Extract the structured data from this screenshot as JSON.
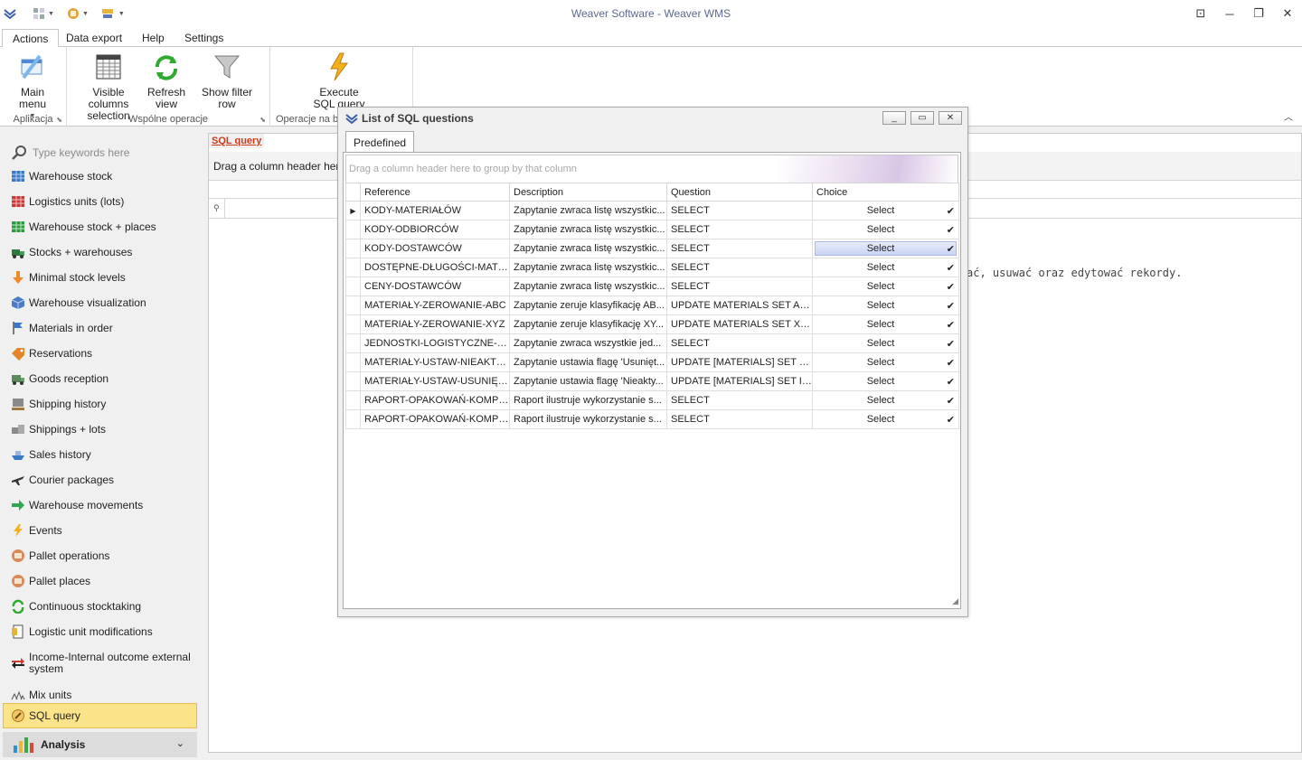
{
  "window": {
    "title": "Weaver Software - Weaver WMS"
  },
  "ribbon": {
    "tabs": [
      "Actions",
      "Data export",
      "Help",
      "Settings"
    ],
    "groups": {
      "aplikacja": {
        "caption": "Aplikacja",
        "main_menu": "Main menu"
      },
      "wspolne": {
        "caption": "Wspólne operacje",
        "visible_columns": "Visible columns selection",
        "refresh": "Refresh view",
        "show_filter": "Show filter row"
      },
      "operacje": {
        "caption": "Operacje na b",
        "execute": "Execute SQL query"
      }
    }
  },
  "nav": {
    "search_placeholder": "Type keywords here",
    "items": [
      {
        "label": "Warehouse stock",
        "icon": "grid-blue-icon"
      },
      {
        "label": "Logistics units (lots)",
        "icon": "grid-red-icon"
      },
      {
        "label": "Warehouse stock + places",
        "icon": "grid-green-icon"
      },
      {
        "label": "Stocks + warehouses",
        "icon": "truck-icon"
      },
      {
        "label": "Minimal stock levels",
        "icon": "down-arrow-icon"
      },
      {
        "label": "Warehouse visualization",
        "icon": "cube-icon"
      },
      {
        "label": "Materials in order",
        "icon": "flag-icon"
      },
      {
        "label": "Reservations",
        "icon": "tag-icon"
      },
      {
        "label": "Goods reception",
        "icon": "truck-in-icon"
      },
      {
        "label": "Shipping history",
        "icon": "pallet-icon"
      },
      {
        "label": "Shippings + lots",
        "icon": "boxes-icon"
      },
      {
        "label": "Sales history",
        "icon": "ship-icon"
      },
      {
        "label": "Courier packages",
        "icon": "plane-icon"
      },
      {
        "label": "Warehouse movements",
        "icon": "arrow-right-icon"
      },
      {
        "label": "Events",
        "icon": "lightning-icon"
      },
      {
        "label": "Pallet operations",
        "icon": "pallet-circle-icon"
      },
      {
        "label": "Pallet places",
        "icon": "pallet-circle-icon"
      },
      {
        "label": "Continuous stocktaking",
        "icon": "cycle-icon"
      },
      {
        "label": "Logistic unit modifications",
        "icon": "document-icon"
      },
      {
        "label": "Income-Internal outcome external system",
        "icon": "swap-arrows-icon"
      },
      {
        "label": "Mix units",
        "icon": "mix-icon"
      }
    ],
    "active": {
      "label": "SQL query",
      "icon": "sql-icon"
    },
    "analysis": {
      "label": "Analysis"
    }
  },
  "doc": {
    "tab": "SQL query",
    "group_hint": "Drag a column header here t",
    "message": "ać, usuwać oraz edytować rekordy."
  },
  "dialog": {
    "title": "List of SQL questions",
    "tab": "Predefined",
    "group_hint": "Drag a column header here to group by that column",
    "columns": [
      "Reference",
      "Description",
      "Question",
      "Choice"
    ],
    "rows": [
      {
        "ref": "KODY-MATERIAŁÓW",
        "desc": "Zapytanie zwraca listę wszystkic...",
        "q": "SELECT",
        "choice": "Select"
      },
      {
        "ref": "KODY-ODBIORCÓW",
        "desc": "Zapytanie zwraca listę wszystkic...",
        "q": "SELECT",
        "choice": "Select"
      },
      {
        "ref": "KODY-DOSTAWCÓW",
        "desc": "Zapytanie zwraca listę wszystkic...",
        "q": "SELECT",
        "choice": "Select"
      },
      {
        "ref": "DOSTĘPNE-DŁUGOŚCI-MATER...",
        "desc": "Zapytanie zwraca listę wszystkic...",
        "q": "SELECT",
        "choice": "Select"
      },
      {
        "ref": "CENY-DOSTAWCÓW",
        "desc": "Zapytanie zwraca listę wszystkic...",
        "q": "SELECT",
        "choice": "Select"
      },
      {
        "ref": "MATERIAŁY-ZEROWANIE-ABC",
        "desc": "Zapytanie zeruje klasyfikację AB...",
        "q": "UPDATE MATERIALS SET ABC...",
        "choice": "Select"
      },
      {
        "ref": "MATERIAŁY-ZEROWANIE-XYZ",
        "desc": "Zapytanie zeruje klasyfikację XY...",
        "q": "UPDATE MATERIALS SET XYZ...",
        "choice": "Select"
      },
      {
        "ref": "JEDNOSTKI-LOGISTYCZNE-NIE...",
        "desc": "Zapytanie zwraca wszystkie jed...",
        "q": "SELECT",
        "choice": "Select"
      },
      {
        "ref": "MATERIAŁY-USTAW-NIEAKTY...",
        "desc": "Zapytanie ustawia flagę 'Usunięt...",
        "q": "UPDATE [MATERIALS] SET RE...",
        "choice": "Select"
      },
      {
        "ref": "MATERIAŁY-USTAW-USUNIĘT...",
        "desc": "Zapytanie ustawia flagę 'Nieakty...",
        "q": "UPDATE [MATERIALS] SET IN...",
        "choice": "Select"
      },
      {
        "ref": "RAPORT-OPAKOWAŃ-KOMPLE...",
        "desc": "Raport ilustruje wykorzystanie s...",
        "q": "SELECT",
        "choice": "Select"
      },
      {
        "ref": "RAPORT-OPAKOWAŃ-KOMPLE...",
        "desc": "Raport ilustruje wykorzystanie s...",
        "q": "SELECT",
        "choice": "Select"
      }
    ]
  },
  "colors": {
    "accent": "#fbe38a",
    "link_red": "#cc3a1a",
    "title_text": "#5a6a8a"
  }
}
